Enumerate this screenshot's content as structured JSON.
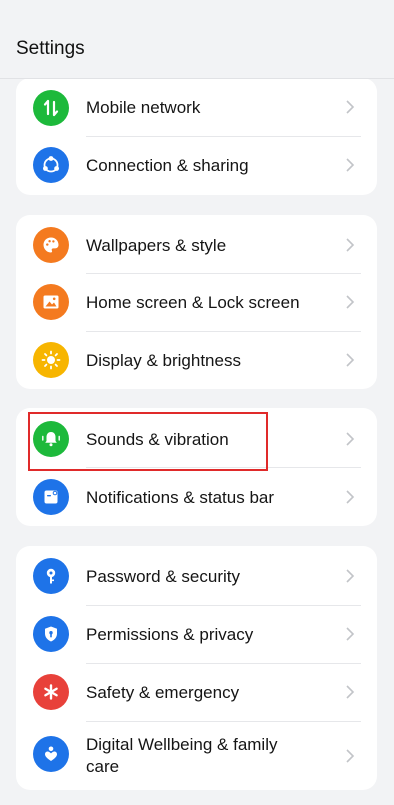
{
  "header": {
    "title": "Settings"
  },
  "groups": [
    {
      "items": [
        {
          "label": "Mobile network",
          "icon": "mobile-data-icon",
          "color": "#1db93b"
        },
        {
          "label": "Connection & sharing",
          "icon": "share-icon",
          "color": "#1e73e8"
        }
      ]
    },
    {
      "items": [
        {
          "label": "Wallpapers & style",
          "icon": "palette-icon",
          "color": "#f47a1f"
        },
        {
          "label": "Home screen & Lock screen",
          "icon": "image-icon",
          "color": "#f47a1f"
        },
        {
          "label": "Display & brightness",
          "icon": "sun-icon",
          "color": "#f7b500"
        }
      ]
    },
    {
      "items": [
        {
          "label": "Sounds & vibration",
          "icon": "bell-vibrate-icon",
          "color": "#1db93b"
        },
        {
          "label": "Notifications & status bar",
          "icon": "notification-icon",
          "color": "#1e73e8"
        }
      ]
    },
    {
      "items": [
        {
          "label": "Password & security",
          "icon": "key-icon",
          "color": "#1e73e8"
        },
        {
          "label": "Permissions & privacy",
          "icon": "shield-icon",
          "color": "#1e73e8"
        },
        {
          "label": "Safety & emergency",
          "icon": "asterisk-icon",
          "color": "#e8413a"
        },
        {
          "label": "Digital Wellbeing & family care",
          "icon": "heart-person-icon",
          "color": "#1e73e8"
        }
      ]
    }
  ]
}
